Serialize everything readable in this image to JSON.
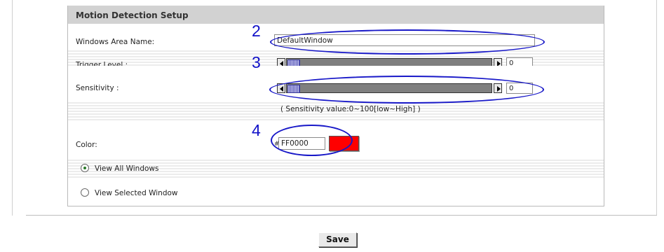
{
  "section": {
    "title": "Motion Detection Setup"
  },
  "window_area": {
    "label": "Windows Area Name:",
    "value": "DefaultWindow"
  },
  "trigger": {
    "label": "Trigger Level :",
    "value": "0",
    "level": 0
  },
  "sensitivity": {
    "label": "Sensitivity :",
    "value": "0",
    "level": 0,
    "hint": "( Sensitivity value:0~100[low~High] )"
  },
  "color": {
    "label": "Color:",
    "hash": "#",
    "value": "FF0000",
    "swatch": "#ff0000"
  },
  "view": {
    "all_label": "View All Windows",
    "selected_label": "View Selected Window",
    "selected_option": "all"
  },
  "annotations": {
    "n2": "2",
    "n3": "3",
    "n4": "4"
  },
  "save_label": "Save",
  "colors": {
    "header_bg": "#d2d2d2",
    "annotation": "#1818c8"
  }
}
